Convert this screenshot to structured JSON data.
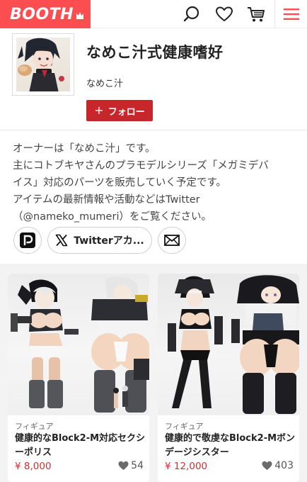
{
  "header": {
    "logo_text": "BOOTH",
    "brand_color": "#fc4d50",
    "icons": [
      "search-icon",
      "heart-icon",
      "cart-icon",
      "menu-icon"
    ]
  },
  "shop": {
    "title": "なめこ汁式健康嗜好",
    "owner": "なめこ汁",
    "follow_label": "フォロー",
    "follow_color": "#c7262b"
  },
  "description": {
    "lines": [
      "オーナーは「なめこ汁」です。",
      "主にコトブキヤさんのプラモデルシリーズ「メガミデバ",
      "イス」対応のパーツを販売していく予定です。",
      "アイテムの最新情報や活動などはTwitter",
      "（@nameko_mumeri）をご覧ください。"
    ]
  },
  "social": {
    "pixiv_icon": "pixiv-icon",
    "twitter_label": "Twitterアカ...",
    "twitter_icon": "x-logo-icon",
    "mail_icon": "mail-icon"
  },
  "items": [
    {
      "category": "フィギュア",
      "title": "健康的なBlock2-M対応セクシーポリス",
      "price": "¥ 8,000",
      "likes": "54"
    },
    {
      "category": "フィギュア",
      "title": "健康的で敬虔なBlock2-Mボンデージシスター",
      "price": "¥ 12,000",
      "likes": "403"
    }
  ]
}
